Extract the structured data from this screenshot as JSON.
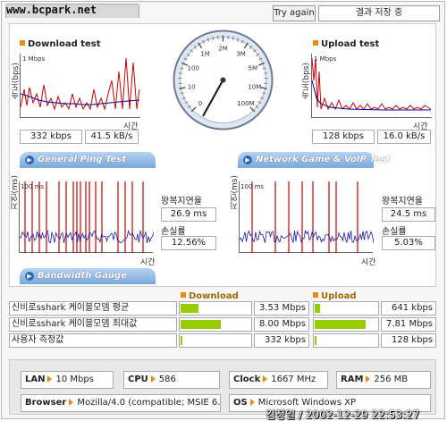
{
  "watermark": "www.bcpark.net",
  "header": {
    "try_again_label": "Try again",
    "save_status": "결과 저장 중"
  },
  "download": {
    "title": "Download test",
    "ylabel": "속도(bps)",
    "scale": "1 Mbps",
    "xlabel": "시간",
    "kbps": "332 kbps",
    "kBs": "41.5 kB/s"
  },
  "upload": {
    "title": "Upload test",
    "ylabel": "속도(bps)",
    "scale": "1 Mbps",
    "xlabel": "시간",
    "kbps": "128 kbps",
    "kBs": "16.0 kB/s"
  },
  "tabs": {
    "ping": "General Ping Test",
    "game": "Network Game & VoIP Test",
    "bandwidth": "Bandwidth Gauge"
  },
  "ping": {
    "ylabel": "지연(ms)",
    "scale": "100 ms",
    "xlabel": "시간",
    "rtt_label": "왕복지연율",
    "rtt": "26.9 ms",
    "loss_label": "손실률",
    "loss": "12.56%"
  },
  "game": {
    "ylabel": "지연(ms)",
    "scale": "100 ms",
    "xlabel": "시간",
    "rtt_label": "왕복지연율",
    "rtt": "24.5 ms",
    "loss_label": "손실률",
    "loss": "5.03%"
  },
  "gauge": {
    "download_header": "Download",
    "upload_header": "Upload",
    "accent_color": "#99cc00",
    "rows": [
      {
        "name": "신비로sshark 케이블모뎀 평균",
        "download": "3.53 Mbps",
        "download_fraction": 0.26,
        "upload": "641 kbps",
        "upload_fraction": 0.09
      },
      {
        "name": "신비로sshark 케이블모뎀 최대값",
        "download": "8.00 Mbps",
        "download_fraction": 0.59,
        "upload": "7.81 Mbps",
        "upload_fraction": 0.84
      },
      {
        "name": "사용자 측정값",
        "download": "332 kbps",
        "download_fraction": 0.03,
        "upload": "128 kbps",
        "upload_fraction": 0.02
      }
    ]
  },
  "system": {
    "lan_label": "LAN",
    "lan": "10 Mbps",
    "cpu_label": "CPU",
    "cpu": "586",
    "clock_label": "Clock",
    "clock": "1667 MHz",
    "ram_label": "RAM",
    "ram": "256 MB",
    "browser_label": "Browser",
    "browser": "Mozilla/4.0 (compatible; MSIE 6.0",
    "os_label": "OS",
    "os": "Microsoft Windows XP"
  },
  "stamp": "김정일 / 2002-12-29 22:53:27",
  "speedometer": {
    "ticks": [
      "0",
      "10",
      "100",
      "1M",
      "2M",
      "3M",
      "5M",
      "10M",
      "100M"
    ]
  },
  "colors": {
    "download_line": "#cc0000",
    "download_avg": "#000099",
    "accent": "#e88b12",
    "tab_blue": "#2d69b5"
  }
}
